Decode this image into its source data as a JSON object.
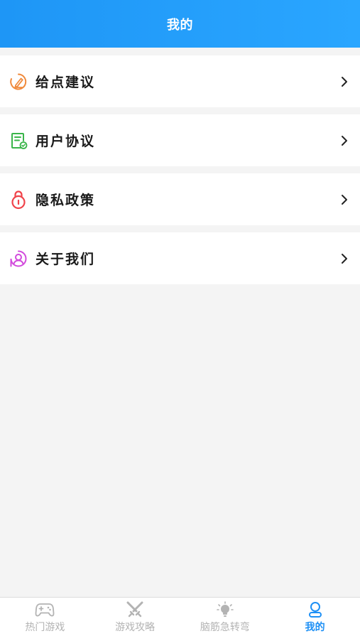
{
  "header": {
    "title": "我的"
  },
  "menu": {
    "items": [
      {
        "label": "给点建议",
        "icon": "feedback-pencil-icon",
        "color": "#f08a3c"
      },
      {
        "label": "用户协议",
        "icon": "document-check-icon",
        "color": "#3ab54a"
      },
      {
        "label": "隐私政策",
        "icon": "lock-icon",
        "color": "#f0434a"
      },
      {
        "label": "关于我们",
        "icon": "about-user-icon",
        "color": "#d24bdc"
      }
    ]
  },
  "tabbar": {
    "tabs": [
      {
        "label": "热门游戏",
        "icon": "gamepad-icon",
        "active": false
      },
      {
        "label": "游戏攻略",
        "icon": "crossed-swords-icon",
        "active": false
      },
      {
        "label": "脑筋急转弯",
        "icon": "lightbulb-icon",
        "active": false
      },
      {
        "label": "我的",
        "icon": "profile-icon",
        "active": true
      }
    ]
  },
  "colors": {
    "header_gradient_start": "#1e96f6",
    "header_gradient_end": "#2aa6ff",
    "tab_active": "#1e90f5",
    "tab_inactive": "#b3b3b3"
  }
}
